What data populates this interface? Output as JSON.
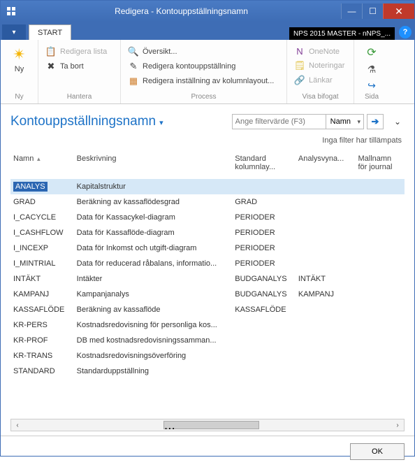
{
  "window": {
    "title": "Redigera - Kontouppställningsnamn",
    "badge": "NPS 2015 MASTER - nNPS_..."
  },
  "tabs": {
    "file_arrow": "▾",
    "start": "START"
  },
  "ribbon": {
    "new": {
      "label": "Ny",
      "group": "Ny"
    },
    "manage": {
      "edit_list": "Redigera lista",
      "delete": "Ta bort",
      "group": "Hantera"
    },
    "process": {
      "overview": "Översikt...",
      "edit_schedule": "Redigera kontouppställning",
      "edit_column_layout": "Redigera inställning av kolumnlayout...",
      "group": "Process"
    },
    "attach": {
      "onenote": "OneNote",
      "notes": "Noteringar",
      "links": "Länkar",
      "group": "Visa bifogat"
    },
    "page": {
      "group": "Sida"
    }
  },
  "page": {
    "title": "Kontouppställningsnamn",
    "filter_placeholder": "Ange filtervärde (F3)",
    "filter_field": "Namn",
    "filter_status": "Inga filter har tillämpats"
  },
  "columns": {
    "name": "Namn",
    "description": "Beskrivning",
    "std_col": "Standard kolumnlay...",
    "analysis": "Analysvyna...",
    "journal": "Mallnamn för journal"
  },
  "rows": [
    {
      "name": "ANALYS",
      "desc": "Kapitalstruktur",
      "col": "",
      "av": "",
      "jn": ""
    },
    {
      "name": "GRAD",
      "desc": "Beräkning av kassaflödesgrad",
      "col": "GRAD",
      "av": "",
      "jn": ""
    },
    {
      "name": "I_CACYCLE",
      "desc": "Data för Kassacykel-diagram",
      "col": "PERIODER",
      "av": "",
      "jn": ""
    },
    {
      "name": "I_CASHFLOW",
      "desc": "Data för Kassaflöde-diagram",
      "col": "PERIODER",
      "av": "",
      "jn": ""
    },
    {
      "name": "I_INCEXP",
      "desc": "Data för Inkomst och utgift-diagram",
      "col": "PERIODER",
      "av": "",
      "jn": ""
    },
    {
      "name": "I_MINTRIAL",
      "desc": "Data för reducerad råbalans, informatio...",
      "col": "PERIODER",
      "av": "",
      "jn": ""
    },
    {
      "name": "INTÄKT",
      "desc": "Intäkter",
      "col": "BUDGANALYS",
      "av": "INTÄKT",
      "jn": ""
    },
    {
      "name": "KAMPANJ",
      "desc": "Kampanjanalys",
      "col": "BUDGANALYS",
      "av": "KAMPANJ",
      "jn": ""
    },
    {
      "name": "KASSAFLÖDE",
      "desc": "Beräkning av kassaflöde",
      "col": "KASSAFLÖDE",
      "av": "",
      "jn": ""
    },
    {
      "name": "KR-PERS",
      "desc": "Kostnadsredovisning för personliga kos...",
      "col": "",
      "av": "",
      "jn": ""
    },
    {
      "name": "KR-PROF",
      "desc": "DB med kostnadsredovisningssamman...",
      "col": "",
      "av": "",
      "jn": ""
    },
    {
      "name": "KR-TRANS",
      "desc": "Kostnadsredovisningsöverföring",
      "col": "",
      "av": "",
      "jn": ""
    },
    {
      "name": "STANDARD",
      "desc": "Standarduppställning",
      "col": "",
      "av": "",
      "jn": ""
    }
  ],
  "footer": {
    "ok": "OK"
  }
}
